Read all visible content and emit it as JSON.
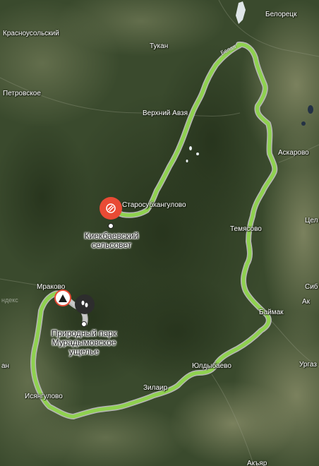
{
  "places": [
    {
      "id": "beloretsk",
      "name": "Белорецк"
    },
    {
      "id": "krasnousolsky",
      "name": "Красноусольский"
    },
    {
      "id": "tukan",
      "name": "Тукан"
    },
    {
      "id": "petrovskoe",
      "name": "Петровское"
    },
    {
      "id": "verkhny-avzyan",
      "name": "Верхний Авзя"
    },
    {
      "id": "askarovo",
      "name": "Аскарово"
    },
    {
      "id": "starosubkhangulovo",
      "name": "Старосубхангулово"
    },
    {
      "id": "temyasovo",
      "name": "Темясово"
    },
    {
      "id": "cel",
      "name": "Цел"
    },
    {
      "id": "mrakovo",
      "name": "Мраково"
    },
    {
      "id": "sib",
      "name": "Сиб"
    },
    {
      "id": "baymak",
      "name": "Баймак"
    },
    {
      "id": "yuldybaevo",
      "name": "Юлдыбаево"
    },
    {
      "id": "urgaz",
      "name": "Ургаз"
    },
    {
      "id": "zilair",
      "name": "Зилаир"
    },
    {
      "id": "isyangulovo",
      "name": "Исянгулово"
    },
    {
      "id": "ak",
      "name": "Ак"
    },
    {
      "id": "akyar",
      "name": "Акъяр"
    },
    {
      "id": "an",
      "name": "ан"
    }
  ],
  "pois": {
    "kiekbaevsky": {
      "line1": "Киекбаевский",
      "line2": "сельсовет",
      "color": "#e94b35",
      "icon": "stripes-icon"
    },
    "muradymovo": {
      "line1": "Природный парк",
      "line2": "Мурадымовское",
      "line3": "ущелье",
      "color": "#2d2d2d",
      "icon": "footprints-icon"
    },
    "warning": {
      "glyph": "!",
      "color": "#e94b35"
    }
  },
  "road_label": "Белая",
  "watermark": "ндекс",
  "route_color": "#8fd14f"
}
